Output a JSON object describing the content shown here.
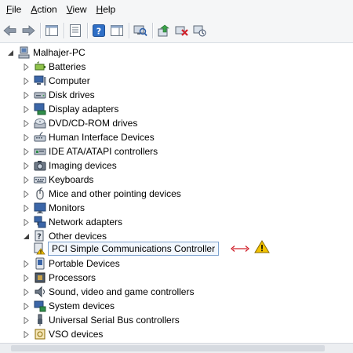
{
  "menu": [
    {
      "acc": "F",
      "rest": "ile"
    },
    {
      "acc": "A",
      "rest": "ction"
    },
    {
      "acc": "V",
      "rest": "iew"
    },
    {
      "acc": "H",
      "rest": "elp"
    }
  ],
  "toolbar": {
    "icons": [
      "back-arrow-icon",
      "forward-arrow-icon",
      "show-hide-console-tree-icon",
      "properties-icon",
      "help-icon",
      "action-pane-icon",
      "scan-hardware-icon",
      "update-driver-icon",
      "uninstall-icon",
      "disable-device-icon"
    ]
  },
  "tree": {
    "root": "Malhajer-PC",
    "categories": [
      "Batteries",
      "Computer",
      "Disk drives",
      "Display adapters",
      "DVD/CD-ROM drives",
      "Human Interface Devices",
      "IDE ATA/ATAPI controllers",
      "Imaging devices",
      "Keyboards",
      "Mice and other pointing devices",
      "Monitors",
      "Network adapters",
      "Other devices",
      "Portable Devices",
      "Processors",
      "Sound, video and game controllers",
      "System devices",
      "Universal Serial Bus controllers",
      "VSO devices"
    ],
    "other_devices_child": "PCI Simple Communications Controller"
  },
  "colors": {
    "accent_arrow": "#d0212b",
    "warning": "#f2c200",
    "selection_border": "#7da2ce"
  }
}
